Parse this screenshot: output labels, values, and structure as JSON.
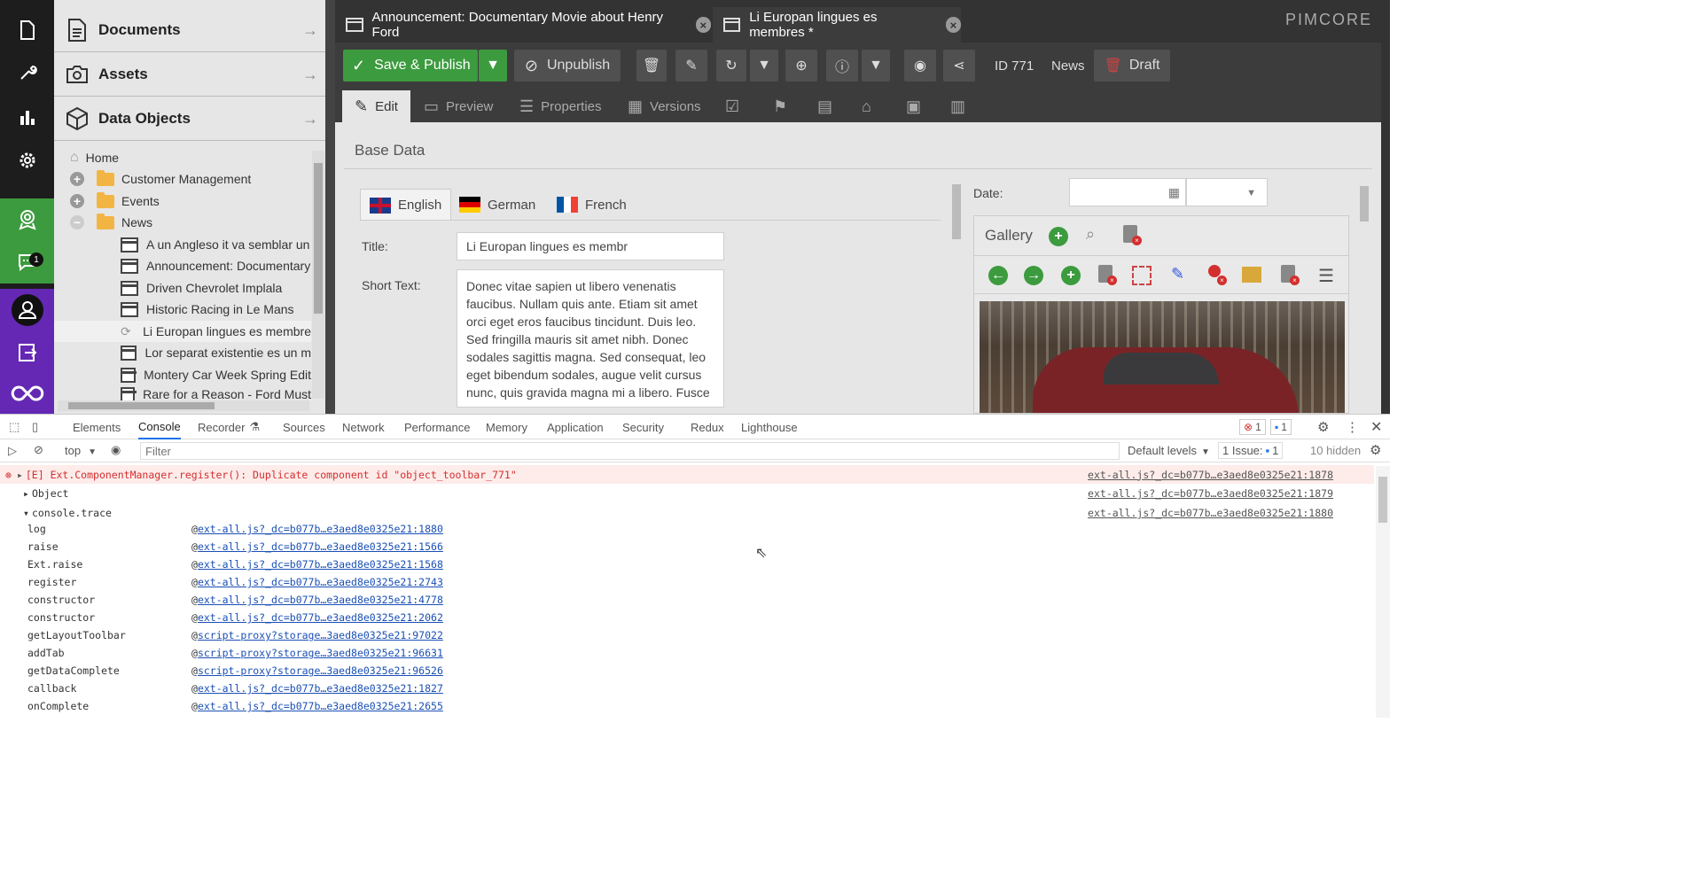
{
  "rail": {
    "chat_badge": "1"
  },
  "accordion": [
    {
      "label": "Documents"
    },
    {
      "label": "Assets"
    },
    {
      "label": "Data Objects"
    }
  ],
  "tree": {
    "home": "Home",
    "folders": [
      "Customer Management",
      "Events",
      "News"
    ],
    "items": [
      "A un Angleso it va semblar un",
      "Announcement: Documentary",
      "Driven Chevrolet Implala",
      "Historic Racing in Le Mans",
      "Li Europan lingues es membre",
      "Lor separat existentie es un m",
      "Montery Car Week Spring Edit",
      "Rare for a Reason - Ford Must"
    ]
  },
  "tabs": [
    {
      "label": "Announcement: Documentary Movie about Henry Ford"
    },
    {
      "label": "Li Europan lingues es membres *"
    }
  ],
  "logo": "PIMCORE",
  "toolbar": {
    "save_publish": "Save & Publish",
    "unpublish": "Unpublish",
    "id": "ID 771",
    "type": "News",
    "draft": "Draft"
  },
  "subtabs": {
    "edit": "Edit",
    "preview": "Preview",
    "properties": "Properties",
    "versions": "Versions"
  },
  "content": {
    "section_title": "Base Data",
    "lang_tabs": [
      "English",
      "German",
      "French"
    ],
    "title_label": "Title:",
    "title_value": "Li Europan lingues es membr",
    "short_text_label": "Short Text:",
    "short_text_value": "Donec vitae sapien ut libero venenatis faucibus. Nullam quis ante. Etiam sit amet orci eget eros faucibus tincidunt. Duis leo. Sed fringilla mauris sit amet nibh. Donec sodales sagittis magna. Sed consequat, leo eget bibendum sodales, augue velit cursus nunc, quis gravida magna mi a libero. Fusce",
    "date_label": "Date:",
    "gallery_title": "Gallery"
  },
  "devtools": {
    "tabs": [
      "Elements",
      "Console",
      "Recorder",
      "Sources",
      "Network",
      "Performance",
      "Memory",
      "Application",
      "Security",
      "Redux",
      "Lighthouse"
    ],
    "error_count": "1",
    "msg_count": "1",
    "context": "top",
    "filter_placeholder": "Filter",
    "levels": "Default levels",
    "issues_label": "1 Issue:",
    "issues_count": "1",
    "hidden": "10 hidden",
    "error_msg": "[E] Ext.ComponentManager.register(): Duplicate component id \"object_toolbar_771\"",
    "error_src": "ext-all.js?_dc=b077b…e3aed8e0325e21:1878",
    "object_label": "Object",
    "object_src": "ext-all.js?_dc=b077b…e3aed8e0325e21:1879",
    "trace_label": "console.trace",
    "trace_src": "ext-all.js?_dc=b077b…e3aed8e0325e21:1880",
    "trace": [
      {
        "fn": "log",
        "src": "ext-all.js?_dc=b077b…e3aed8e0325e21:1880"
      },
      {
        "fn": "raise",
        "src": "ext-all.js?_dc=b077b…e3aed8e0325e21:1566"
      },
      {
        "fn": "Ext.raise",
        "src": "ext-all.js?_dc=b077b…e3aed8e0325e21:1568"
      },
      {
        "fn": "register",
        "src": "ext-all.js?_dc=b077b…e3aed8e0325e21:2743"
      },
      {
        "fn": "constructor",
        "src": "ext-all.js?_dc=b077b…e3aed8e0325e21:4778"
      },
      {
        "fn": "constructor",
        "src": "ext-all.js?_dc=b077b…e3aed8e0325e21:2062"
      },
      {
        "fn": "getLayoutToolbar",
        "src": "script-proxy?storage…3aed8e0325e21:97022"
      },
      {
        "fn": "addTab",
        "src": "script-proxy?storage…3aed8e0325e21:96631"
      },
      {
        "fn": "getDataComplete",
        "src": "script-proxy?storage…3aed8e0325e21:96526"
      },
      {
        "fn": "callback",
        "src": "ext-all.js?_dc=b077b…e3aed8e0325e21:1827"
      },
      {
        "fn": "onComplete",
        "src": "ext-all.js?_dc=b077b…e3aed8e0325e21:2655"
      }
    ]
  },
  "colors": {
    "green": "#3c9b3e",
    "purple": "#6428b4",
    "error": "#d32f2f",
    "link": "#1a4fb5"
  }
}
